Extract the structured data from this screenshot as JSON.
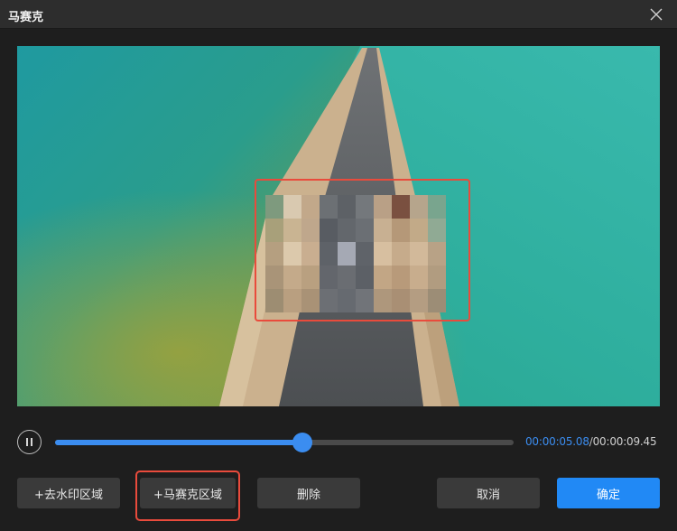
{
  "window": {
    "title": "马赛克",
    "close_icon": "close-icon"
  },
  "player": {
    "current_time": "00:00:05.08",
    "separator": "/",
    "total_time": "00:00:09.45",
    "progress": 0.54,
    "state": "playing",
    "pause_icon": "pause-icon"
  },
  "mosaic": {
    "region_color": "#e94b3c"
  },
  "buttons": {
    "add_watermark_region": "+去水印区域",
    "add_mosaic_region": "+马赛克区域",
    "delete": "删除",
    "cancel": "取消",
    "confirm": "确定"
  },
  "colors": {
    "accent": "#3b8df0",
    "primary_button": "#2189f5",
    "highlight": "#e94b3c"
  }
}
